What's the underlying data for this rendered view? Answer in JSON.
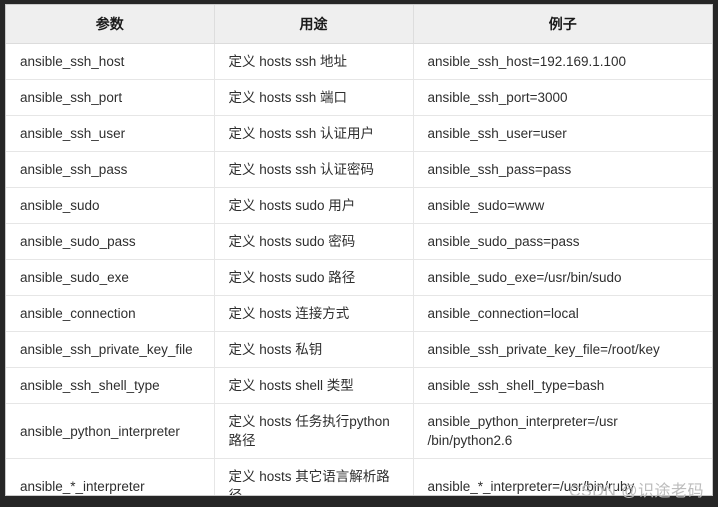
{
  "table": {
    "columns": [
      "参数",
      "用途",
      "例子"
    ],
    "rows": [
      {
        "param": "ansible_ssh_host",
        "usage": [
          "定义 hosts ssh 地址"
        ],
        "sample": [
          "ansible_ssh_host=192.169.1.100"
        ]
      },
      {
        "param": "ansible_ssh_port",
        "usage": [
          "定义 hosts ssh 端口"
        ],
        "sample": [
          "ansible_ssh_port=3000"
        ]
      },
      {
        "param": "ansible_ssh_user",
        "usage": [
          "定义 hosts ssh 认证用户"
        ],
        "sample": [
          "ansible_ssh_user=user"
        ]
      },
      {
        "param": "ansible_ssh_pass",
        "usage": [
          "定义 hosts ssh 认证密码"
        ],
        "sample": [
          "ansible_ssh_pass=pass"
        ]
      },
      {
        "param": "ansible_sudo",
        "usage": [
          "定义 hosts sudo 用户"
        ],
        "sample": [
          "ansible_sudo=www"
        ]
      },
      {
        "param": "ansible_sudo_pass",
        "usage": [
          "定义 hosts sudo 密码"
        ],
        "sample": [
          "ansible_sudo_pass=pass"
        ]
      },
      {
        "param": "ansible_sudo_exe",
        "usage": [
          "定义 hosts sudo 路径"
        ],
        "sample": [
          "ansible_sudo_exe=/usr/bin/sudo"
        ]
      },
      {
        "param": "ansible_connection",
        "usage": [
          "定义 hosts 连接方式"
        ],
        "sample": [
          "ansible_connection=local"
        ]
      },
      {
        "param": "ansible_ssh_private_key_file",
        "usage": [
          "定义 hosts 私钥"
        ],
        "sample": [
          "ansible_ssh_private_key_file=/root/key"
        ]
      },
      {
        "param": "ansible_ssh_shell_type",
        "usage": [
          "定义 hosts shell 类型"
        ],
        "sample": [
          "ansible_ssh_shell_type=bash"
        ]
      },
      {
        "param": "ansible_python_interpreter",
        "usage": [
          "定义 hosts 任务执行python",
          "路径"
        ],
        "sample": [
          "ansible_python_interpreter=/usr",
          "/bin/python2.6"
        ]
      },
      {
        "param": "ansible_*_interpreter",
        "usage": [
          "定义 hosts 其它语言解析路",
          "径"
        ],
        "sample": [
          "ansible_*_interpreter=/usr/bin/ruby"
        ]
      }
    ]
  },
  "watermark": {
    "text": "CSDN @识途老码"
  },
  "colors": {
    "header_background": "#efefef",
    "header_text": "#1a1a1a",
    "cell_text": "#2e2e2e",
    "grid_line": "#e6e6e6",
    "sheet_background": "#ffffff",
    "frame_background": "#262626",
    "watermark_text": "#bdbdbd"
  }
}
